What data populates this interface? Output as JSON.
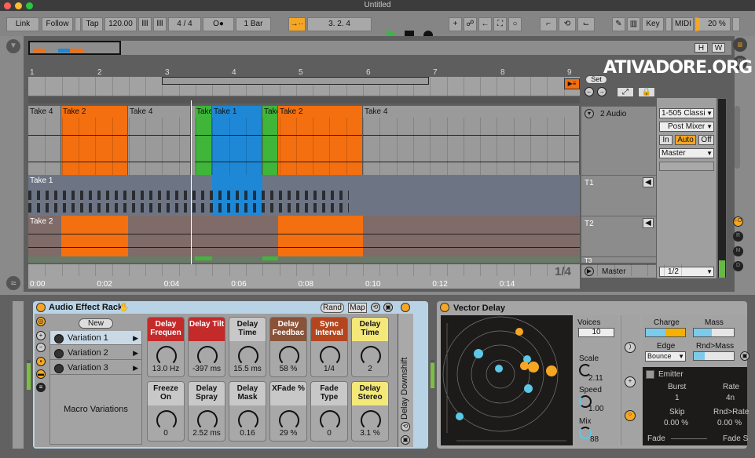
{
  "window": {
    "title": "Untitled"
  },
  "toolbar": {
    "link": "Link",
    "follow": "Follow",
    "tap": "Tap",
    "tempo": "120.00",
    "signature": "4 / 4",
    "metronome": "O●",
    "quantize": "1 Bar",
    "position": "3.  2.  4",
    "key": "Key",
    "midi": "MIDI",
    "cpu": "20 %"
  },
  "overview": {
    "h": "H",
    "w": "W"
  },
  "watermark": "ATIVADORE.ORG",
  "ruler": {
    "bars": [
      "1",
      "2",
      "3",
      "4",
      "5",
      "6",
      "7",
      "8",
      "9"
    ],
    "set": "Set"
  },
  "lanes": {
    "comp": [
      {
        "label": "Take 4",
        "color": "#9a9a9a"
      },
      {
        "label": "Take 2",
        "color": "#f46f0f"
      },
      {
        "label": "Take 4",
        "color": "#9a9a9a"
      },
      {
        "label": "Take",
        "color": "#3fb53a"
      },
      {
        "label": "Take 1",
        "color": "#1e88d6"
      },
      {
        "label": "Take",
        "color": "#3fb53a"
      },
      {
        "label": "Take 2",
        "color": "#f46f0f"
      },
      {
        "label": "Take 4",
        "color": "#9a9a9a"
      }
    ],
    "take1": {
      "label": "Take 1"
    },
    "take2": {
      "label": "Take 2"
    }
  },
  "tracks": {
    "audio": "2 Audio",
    "t1": "T1",
    "t2": "T2",
    "t3": "T3",
    "master": "Master"
  },
  "mixer": {
    "input": "1-505 Classi",
    "monitor_src": "Post Mixer",
    "in": "In",
    "auto": "Auto",
    "off": "Off",
    "output": "Master",
    "master_out": "1/2"
  },
  "side_buttons": [
    "I·O",
    "R",
    "M",
    "D"
  ],
  "timeline": {
    "times": [
      "0:00",
      "0:02",
      "0:04",
      "0:06",
      "0:08",
      "0:10",
      "0:12",
      "0:14"
    ],
    "zoom": "1/4"
  },
  "rack": {
    "title": "Audio Effect Rack",
    "rand": "Rand",
    "map": "Map",
    "new": "New",
    "variations": [
      "Variation 1",
      "Variation 2",
      "Variation 3"
    ],
    "macro_label": "Macro Variations",
    "chain_device": "Delay Downshift",
    "macros": [
      {
        "name": "Delay Frequen",
        "value": "13.0 Hz",
        "color": "#c42a2a",
        "fg": "#fff"
      },
      {
        "name": "Delay Tilt",
        "value": "-397 ms",
        "color": "#c42a2a",
        "fg": "#fff"
      },
      {
        "name": "Delay Time",
        "value": "15.5 ms",
        "color": "#c8c8c8",
        "fg": "#111"
      },
      {
        "name": "Delay Feedbac",
        "value": "58 %",
        "color": "#8a5236",
        "fg": "#fff"
      },
      {
        "name": "Sync Interval",
        "value": "1/4",
        "color": "#b4461f",
        "fg": "#fff"
      },
      {
        "name": "Delay Time",
        "value": "2",
        "color": "#f4e879",
        "fg": "#111"
      },
      {
        "name": "Freeze On",
        "value": "0",
        "color": "#c8c8c8",
        "fg": "#111"
      },
      {
        "name": "Delay Spray",
        "value": "2.52 ms",
        "color": "#c8c8c8",
        "fg": "#111"
      },
      {
        "name": "Delay Mask",
        "value": "0.16",
        "color": "#c8c8c8",
        "fg": "#111"
      },
      {
        "name": "XFade %",
        "value": "29 %",
        "color": "#c8c8c8",
        "fg": "#111"
      },
      {
        "name": "Fade Type",
        "value": "0",
        "color": "#c8c8c8",
        "fg": "#111"
      },
      {
        "name": "Delay Stereo",
        "value": "3.1 %",
        "color": "#f4e879",
        "fg": "#111"
      }
    ]
  },
  "vector_delay": {
    "title": "Vector Delay",
    "voices_label": "Voices",
    "voices": "10",
    "scale_label": "Scale",
    "scale": "2.11",
    "speed_label": "Speed",
    "speed": "1.00",
    "mix_label": "Mix",
    "mix": "88",
    "charge": "Charge",
    "mass": "Mass",
    "edge": "Edge",
    "edge_value": "Bounce",
    "rnd_mass": "Rnd>Mass",
    "emitter": "Emitter",
    "burst_label": "Burst",
    "burst": "1",
    "rate_label": "Rate",
    "rate": "4n",
    "skip_label": "Skip",
    "skip": "0.00 %",
    "rnd_rate_label": "Rnd>Rate",
    "rnd_rate": "0.00 %",
    "fade": "Fade",
    "fade_s": "Fade S"
  }
}
